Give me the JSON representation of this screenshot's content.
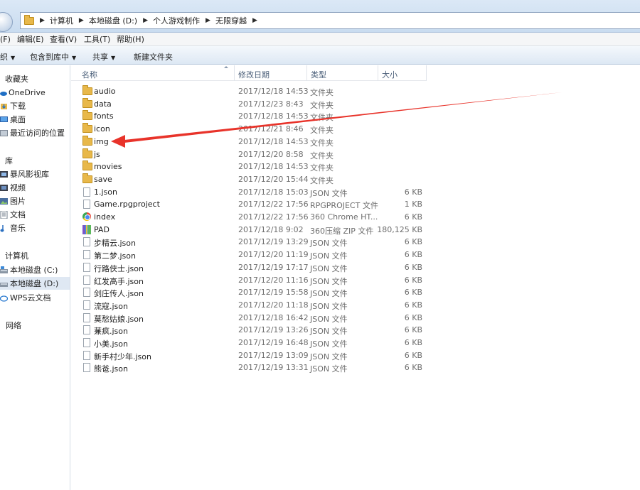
{
  "address": {
    "crumbs": [
      "计算机",
      "本地磁盘 (D:)",
      "个人游戏制作",
      "无限穿越"
    ]
  },
  "menu": [
    "(F)",
    "编辑(E)",
    "查看(V)",
    "工具(T)",
    "帮助(H)"
  ],
  "toolbar": {
    "organize_label": "织",
    "include_label": "包含到库中",
    "share_label": "共享",
    "new_folder_label": "新建文件夹"
  },
  "nav": {
    "favorites": "收藏夹",
    "onedrive": "OneDrive",
    "downloads": "下载",
    "desktop": "桌面",
    "recent": "最近访问的位置",
    "library": "库",
    "baofeng": "暴风影视库",
    "video": "视频",
    "pictures": "图片",
    "documents": "文档",
    "music": "音乐",
    "computer": "计算机",
    "drive_c": "本地磁盘 (C:)",
    "drive_d": "本地磁盘 (D:)",
    "wps": "WPS云文档",
    "network": "网络"
  },
  "columns": {
    "name": "名称",
    "date": "修改日期",
    "type": "类型",
    "size": "大小"
  },
  "files": [
    {
      "name": "audio",
      "date": "2017/12/18 14:53",
      "type": "文件夹",
      "size": "",
      "icon": "folder"
    },
    {
      "name": "data",
      "date": "2017/12/23 8:43",
      "type": "文件夹",
      "size": "",
      "icon": "folder"
    },
    {
      "name": "fonts",
      "date": "2017/12/18 14:53",
      "type": "文件夹",
      "size": "",
      "icon": "folder"
    },
    {
      "name": "icon",
      "date": "2017/12/21 8:46",
      "type": "文件夹",
      "size": "",
      "icon": "folder"
    },
    {
      "name": "img",
      "date": "2017/12/18 14:53",
      "type": "文件夹",
      "size": "",
      "icon": "folder"
    },
    {
      "name": "js",
      "date": "2017/12/20 8:58",
      "type": "文件夹",
      "size": "",
      "icon": "folder"
    },
    {
      "name": "movies",
      "date": "2017/12/18 14:53",
      "type": "文件夹",
      "size": "",
      "icon": "folder"
    },
    {
      "name": "save",
      "date": "2017/12/20 15:44",
      "type": "文件夹",
      "size": "",
      "icon": "folder"
    },
    {
      "name": "1.json",
      "date": "2017/12/18 15:03",
      "type": "JSON 文件",
      "size": "6 KB",
      "icon": "file"
    },
    {
      "name": "Game.rpgproject",
      "date": "2017/12/22 17:56",
      "type": "RPGPROJECT 文件",
      "size": "1 KB",
      "icon": "file"
    },
    {
      "name": "index",
      "date": "2017/12/22 17:56",
      "type": "360 Chrome HT...",
      "size": "6 KB",
      "icon": "chrome"
    },
    {
      "name": "PAD",
      "date": "2017/12/18 9:02",
      "type": "360压缩 ZIP 文件",
      "size": "180,125 KB",
      "icon": "zip"
    },
    {
      "name": "步精云.json",
      "date": "2017/12/19 13:29",
      "type": "JSON 文件",
      "size": "6 KB",
      "icon": "file"
    },
    {
      "name": "第二梦.json",
      "date": "2017/12/20 11:19",
      "type": "JSON 文件",
      "size": "6 KB",
      "icon": "file"
    },
    {
      "name": "行路侠士.json",
      "date": "2017/12/19 17:17",
      "type": "JSON 文件",
      "size": "6 KB",
      "icon": "file"
    },
    {
      "name": "红发高手.json",
      "date": "2017/12/20 11:16",
      "type": "JSON 文件",
      "size": "6 KB",
      "icon": "file"
    },
    {
      "name": "剑庄传人.json",
      "date": "2017/12/19 15:58",
      "type": "JSON 文件",
      "size": "6 KB",
      "icon": "file"
    },
    {
      "name": "流寇.json",
      "date": "2017/12/20 11:18",
      "type": "JSON 文件",
      "size": "6 KB",
      "icon": "file"
    },
    {
      "name": "莫愁姑娘.json",
      "date": "2017/12/18 16:42",
      "type": "JSON 文件",
      "size": "6 KB",
      "icon": "file"
    },
    {
      "name": "蒹疯.json",
      "date": "2017/12/19 13:26",
      "type": "JSON 文件",
      "size": "6 KB",
      "icon": "file"
    },
    {
      "name": "小美.json",
      "date": "2017/12/19 16:48",
      "type": "JSON 文件",
      "size": "6 KB",
      "icon": "file"
    },
    {
      "name": "新手村少年.json",
      "date": "2017/12/19 13:09",
      "type": "JSON 文件",
      "size": "6 KB",
      "icon": "file"
    },
    {
      "name": "熊爸.json",
      "date": "2017/12/19 13:31",
      "type": "JSON 文件",
      "size": "6 KB",
      "icon": "file"
    }
  ],
  "annotation": {
    "arrow_color": "#e8332a",
    "target": "img"
  }
}
